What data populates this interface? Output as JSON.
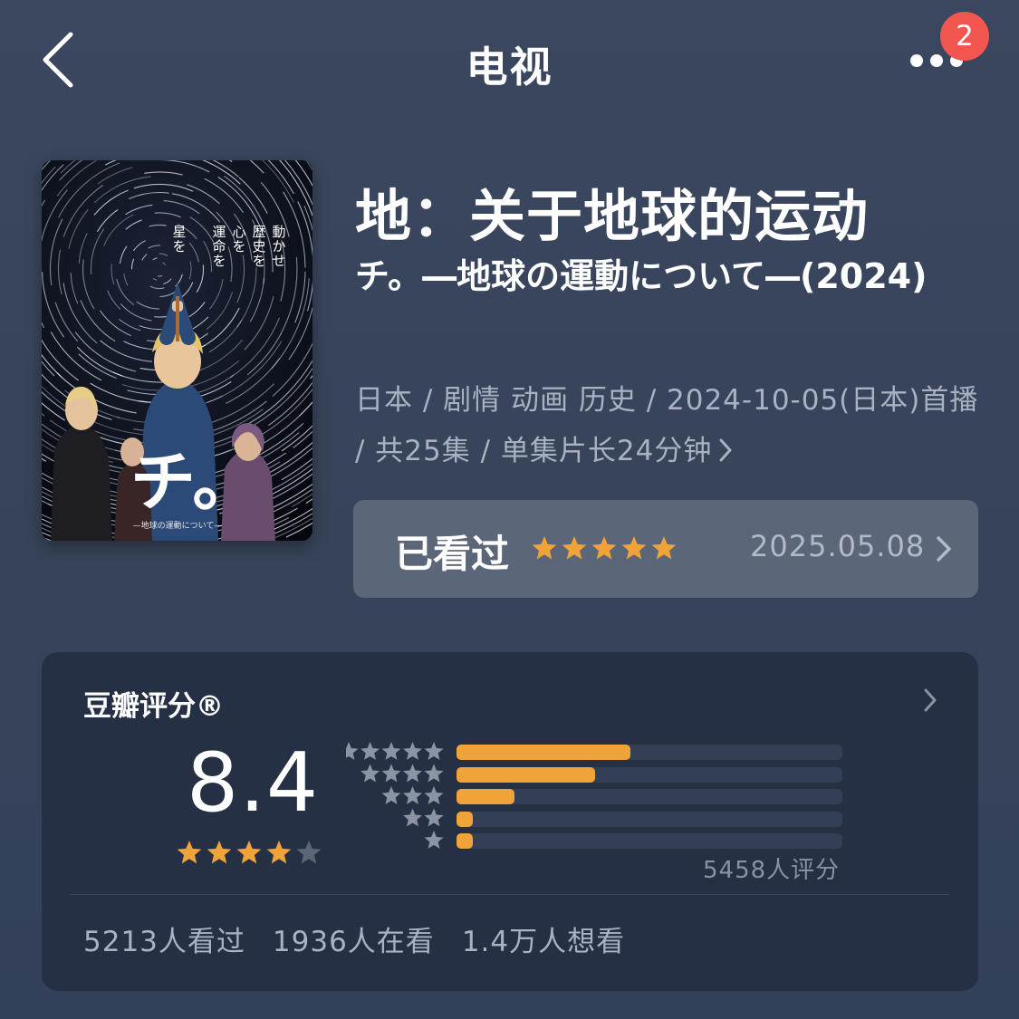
{
  "header": {
    "title": "电视",
    "notification_count": "2",
    "back_icon": "chevron-left-icon",
    "more_icon": "more-dots-icon"
  },
  "poster": {
    "vertical_text": [
      "動かせ",
      "歴史を",
      "心を",
      "運命を",
      "星を"
    ],
    "big_glyph": "チ。",
    "subtitle": "—地球の運動について—"
  },
  "show": {
    "title": "地：关于地球的运动",
    "original_title": "チ。―地球の運動について―(2024)",
    "meta": "日本 / 剧情 动画 历史 / 2024-10-05(日本)首播 / 共25集 / 单集片长24分钟"
  },
  "watched": {
    "label": "已看过",
    "stars": 5,
    "date": "2025.05.08"
  },
  "rating": {
    "title": "豆瓣评分®",
    "score": "8.4",
    "score_stars": 4.2,
    "count_label": "5458人评分",
    "distribution": [
      {
        "stars": 5,
        "fraction": 0.45
      },
      {
        "stars": 4,
        "fraction": 0.36
      },
      {
        "stars": 3,
        "fraction": 0.15
      },
      {
        "stars": 2,
        "fraction": 0.04
      },
      {
        "stars": 1,
        "fraction": 0.04
      }
    ],
    "stats": [
      "5213人看过",
      "1936人在看",
      "1.4万人想看"
    ]
  },
  "colors": {
    "accent_star": "#f0a338",
    "badge": "#f2564f",
    "background": "#374359"
  }
}
